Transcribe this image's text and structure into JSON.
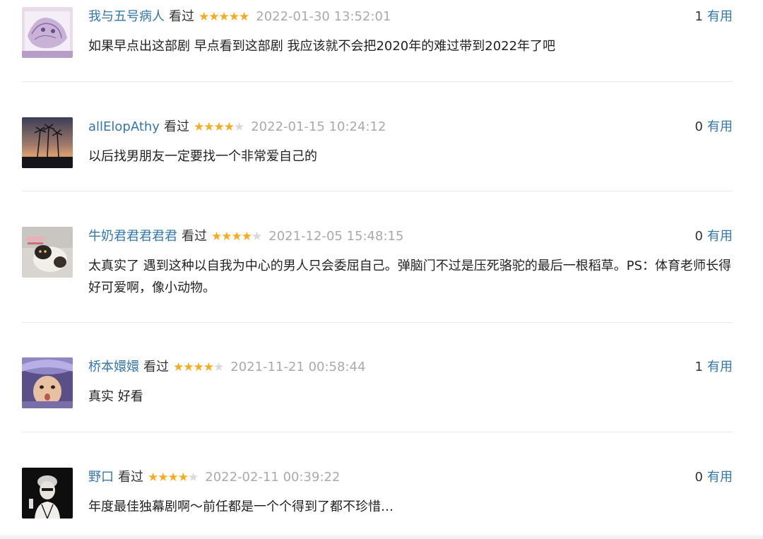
{
  "comments": [
    {
      "username": "我与五号病人",
      "status": "看过",
      "rating": 5,
      "time": "2022-01-30 13:52:01",
      "votes": "1",
      "useful_label": "有用",
      "content": "如果早点出这部剧 早点看到这部剧 我应该就不会把2020年的难过带到2022年了吧",
      "avatar_icon": "sketch-avatar-icon"
    },
    {
      "username": "allElopAthy",
      "status": "看过",
      "rating": 4,
      "time": "2022-01-15 10:24:12",
      "votes": "0",
      "useful_label": "有用",
      "content": "以后找男朋友一定要找一个非常爱自己的",
      "avatar_icon": "palm-sunset-avatar-icon"
    },
    {
      "username": "牛奶君君君君君",
      "status": "看过",
      "rating": 4,
      "time": "2021-12-05 15:48:15",
      "votes": "0",
      "useful_label": "有用",
      "content": "太真实了 遇到这种以自我为中心的男人只会委屈自己。弹脑门不过是压死骆驼的最后一根稻草。PS：体育老师长得好可爱啊，像小动物。",
      "avatar_icon": "cat-avatar-icon"
    },
    {
      "username": "桥本嬛嬛",
      "status": "看过",
      "rating": 4,
      "time": "2021-11-21 00:58:44",
      "votes": "1",
      "useful_label": "有用",
      "content": "真实 好看",
      "avatar_icon": "face-avatar-icon"
    },
    {
      "username": "野口",
      "status": "看过",
      "rating": 4,
      "time": "2022-02-11 00:39:22",
      "votes": "0",
      "useful_label": "有用",
      "content": "年度最佳独幕剧啊～前任都是一个个得到了都不珍惜…",
      "avatar_icon": "performer-avatar-icon"
    }
  ],
  "colors": {
    "username": "#3377aa",
    "star_on": "#f7ac1f",
    "star_off": "#d9d9d9",
    "time": "#aaaaaa",
    "text": "#222222",
    "divider": "#e8e8e8"
  }
}
